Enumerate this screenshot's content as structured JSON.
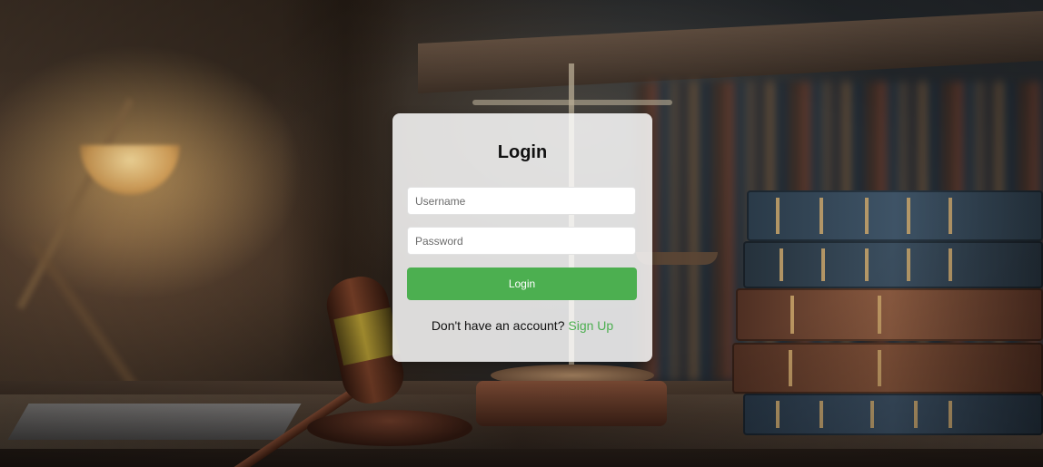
{
  "login": {
    "title": "Login",
    "username_placeholder": "Username",
    "password_placeholder": "Password",
    "login_button": "Login",
    "signup_prompt": "Don't have an account?",
    "signup_link": "Sign Up"
  },
  "colors": {
    "accent": "#4caf50",
    "card_background": "#ffffffd6"
  }
}
